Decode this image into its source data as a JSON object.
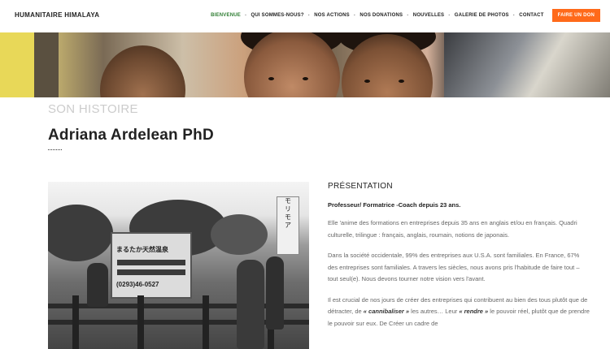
{
  "header": {
    "brand": "HUMANITAIRE HIMALAYA",
    "nav": [
      {
        "label": "BIENVENUE",
        "active": true
      },
      {
        "label": "QUI SOMMES-NOUS?",
        "active": false
      },
      {
        "label": "NOS ACTIONS",
        "active": false
      },
      {
        "label": "NOS DONATIONS",
        "active": false
      },
      {
        "label": "NOUVELLES",
        "active": false
      },
      {
        "label": "GALERIE DE PHOTOS",
        "active": false
      },
      {
        "label": "CONTACT",
        "active": false
      }
    ],
    "cta_label": "FAIRE UN DON",
    "active_color": "#2e7d32",
    "cta_color": "#ff6a1a"
  },
  "section": {
    "eyebrow": "SON HISTOIRE",
    "title": "Adriana Ardelean PhD"
  },
  "photo": {
    "sign_line1": "まるたか天然温泉",
    "sign_line2": "(0293)46-0527",
    "banner_text": [
      "モ",
      "リ",
      "モ",
      "ア"
    ]
  },
  "content": {
    "heading": "PRÉSENTATION",
    "lead": "Professeur/ Formatrice -Coach depuis 23 ans.",
    "p1": "Elle 'anime des formations en entreprises depuis 35 ans en anglais et/ou en français. Quadri culturelle, trilingue : français, anglais, roumain, notions de japonais.",
    "p2": "Dans la société occidentale, 99% des entreprises aux U.S.A. sont familiales. En France, 67% des entreprises sont familiales. A travers les siècles, nous avons pris l'habitude de faire tout – tout seul(e). Nous devons tourner notre vision vers l'avant.",
    "p3_before": "Il est crucial de nos jours de créer des entreprises qui contribuent au bien des tous plutôt que de détracter, de ",
    "p3_em1": "« cannibaliser »",
    "p3_middle": " les autres… Leur ",
    "p3_em2": "« rendre »",
    "p3_after": " le pouvoir réel, plutôt que de prendre le pouvoir sur eux. De Créer un cadre de"
  }
}
